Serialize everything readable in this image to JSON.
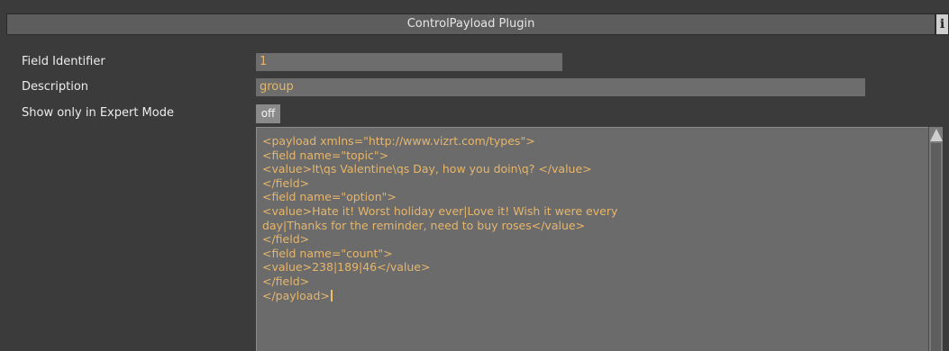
{
  "window": {
    "title": "ControlPayload Plugin",
    "info_icon_glyph": "i"
  },
  "form": {
    "field_identifier": {
      "label": "Field Identifier",
      "value": "1"
    },
    "description": {
      "label": "Description",
      "value": "group"
    },
    "expert_mode": {
      "label": "Show only in Expert Mode",
      "value": "off"
    }
  },
  "editor": {
    "lines": [
      "<payload xmlns=\"http://www.vizrt.com/types\">",
      "<field name=\"topic\">",
      "<value>It\\qs Valentine\\qs Day, how you doin\\q? </value>",
      "</field>",
      "<field name=\"option\">",
      "<value>Hate it! Worst holiday ever|Love it! Wish it were every",
      "day|Thanks for the reminder, need to buy roses</value>",
      "</field>",
      "<field name=\"count\">",
      "<value>238|189|46</value>",
      "</field>",
      "</payload>"
    ]
  },
  "colors": {
    "panel_bg": "#3b3b3b",
    "field_bg": "#6d6d6d",
    "value_text": "#e7b66a",
    "label_text": "#ececec"
  }
}
